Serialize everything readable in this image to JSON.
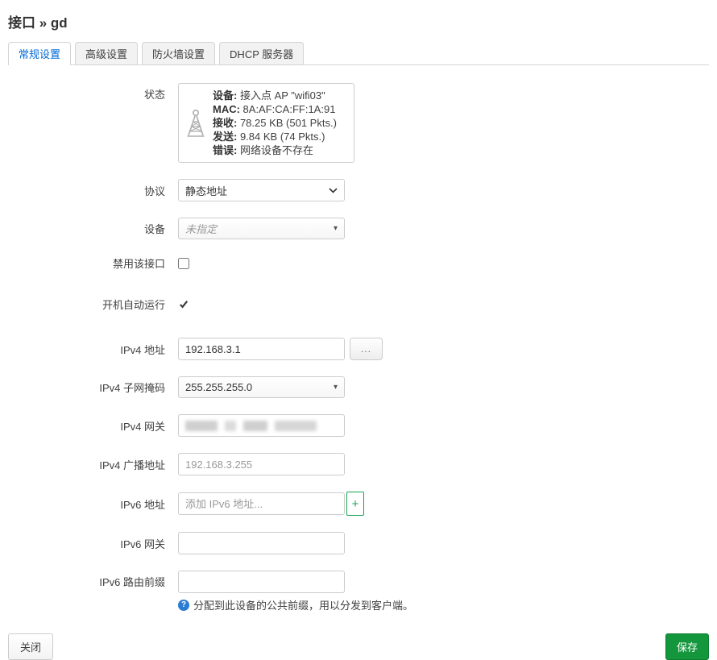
{
  "page": {
    "title": "接口 » gd"
  },
  "tabs": [
    {
      "label": "常规设置",
      "active": true
    },
    {
      "label": "高级设置",
      "active": false
    },
    {
      "label": "防火墙设置",
      "active": false
    },
    {
      "label": "DHCP 服务器",
      "active": false
    }
  ],
  "status": {
    "label": "状态",
    "icon": "antenna-icon",
    "lines": [
      {
        "key": "设备:",
        "value": " 接入点 AP \"wifi03\""
      },
      {
        "key": "MAC:",
        "value": " 8A:AF:CA:FF:1A:91"
      },
      {
        "key": "接收:",
        "value": " 78.25 KB (501 Pkts.)"
      },
      {
        "key": "发送:",
        "value": " 9.84 KB (74 Pkts.)"
      },
      {
        "key": "错误:",
        "value": " 网络设备不存在"
      }
    ]
  },
  "fields": {
    "protocol": {
      "label": "协议",
      "value": "静态地址"
    },
    "device": {
      "label": "设备",
      "value": "未指定"
    },
    "disable_iface": {
      "label": "禁用该接口",
      "checked": false
    },
    "auto_start": {
      "label": "开机自动运行",
      "checked": true
    },
    "ipv4_address": {
      "label": "IPv4 地址",
      "value": "192.168.3.1",
      "more_label": "..."
    },
    "ipv4_netmask": {
      "label": "IPv4 子网掩码",
      "value": "255.255.255.0"
    },
    "ipv4_gateway": {
      "label": "IPv4 网关"
    },
    "ipv4_broadcast": {
      "label": "IPv4 广播地址",
      "placeholder": "192.168.3.255"
    },
    "ipv6_address": {
      "label": "IPv6 地址",
      "placeholder": "添加 IPv6 地址...",
      "add_label": "+"
    },
    "ipv6_gateway": {
      "label": "IPv6 网关"
    },
    "ipv6_prefix": {
      "label": "IPv6 路由前缀",
      "help": "分配到此设备的公共前缀，用以分发到客户端。",
      "help_icon": "?"
    }
  },
  "actions": {
    "close": "关闭",
    "save": "保存"
  },
  "colors": {
    "accent_blue": "#0069d6",
    "save_green": "#14963c",
    "add_green": "#13a454"
  }
}
